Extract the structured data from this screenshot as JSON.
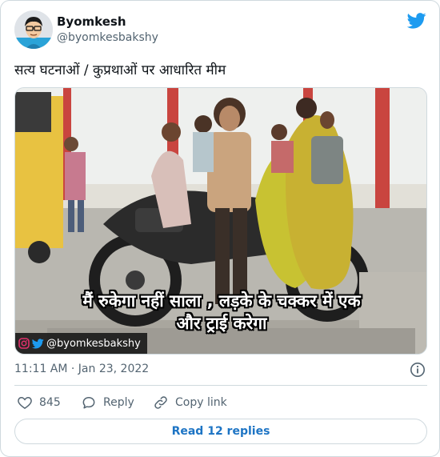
{
  "tweet": {
    "author_name": "Byomkesh",
    "author_handle": "@byomkesbakshy",
    "text": "सत्य घटनाओं / कुप्रथाओं पर आधारित मीम",
    "timestamp": "11:11 AM · Jan 23, 2022"
  },
  "media": {
    "caption_line1": "मैं रुकेगा नहीं साला , लड़के के चक्कर में एक",
    "caption_line2": "और ट्राई करेगा",
    "watermark_handle": "@byomkesbakshy"
  },
  "actions": {
    "like_count": "845",
    "reply_label": "Reply",
    "copy_link_label": "Copy link",
    "read_replies_label": "Read 12 replies"
  },
  "icons": {
    "brand": "twitter-bird-icon",
    "like": "heart-icon",
    "reply": "reply-bubble-icon",
    "copy": "link-icon",
    "info": "info-icon"
  },
  "colors": {
    "twitter_blue": "#1d9bf0",
    "link_blue": "#1d74c4",
    "muted": "#536471",
    "border": "#cfd9de"
  }
}
